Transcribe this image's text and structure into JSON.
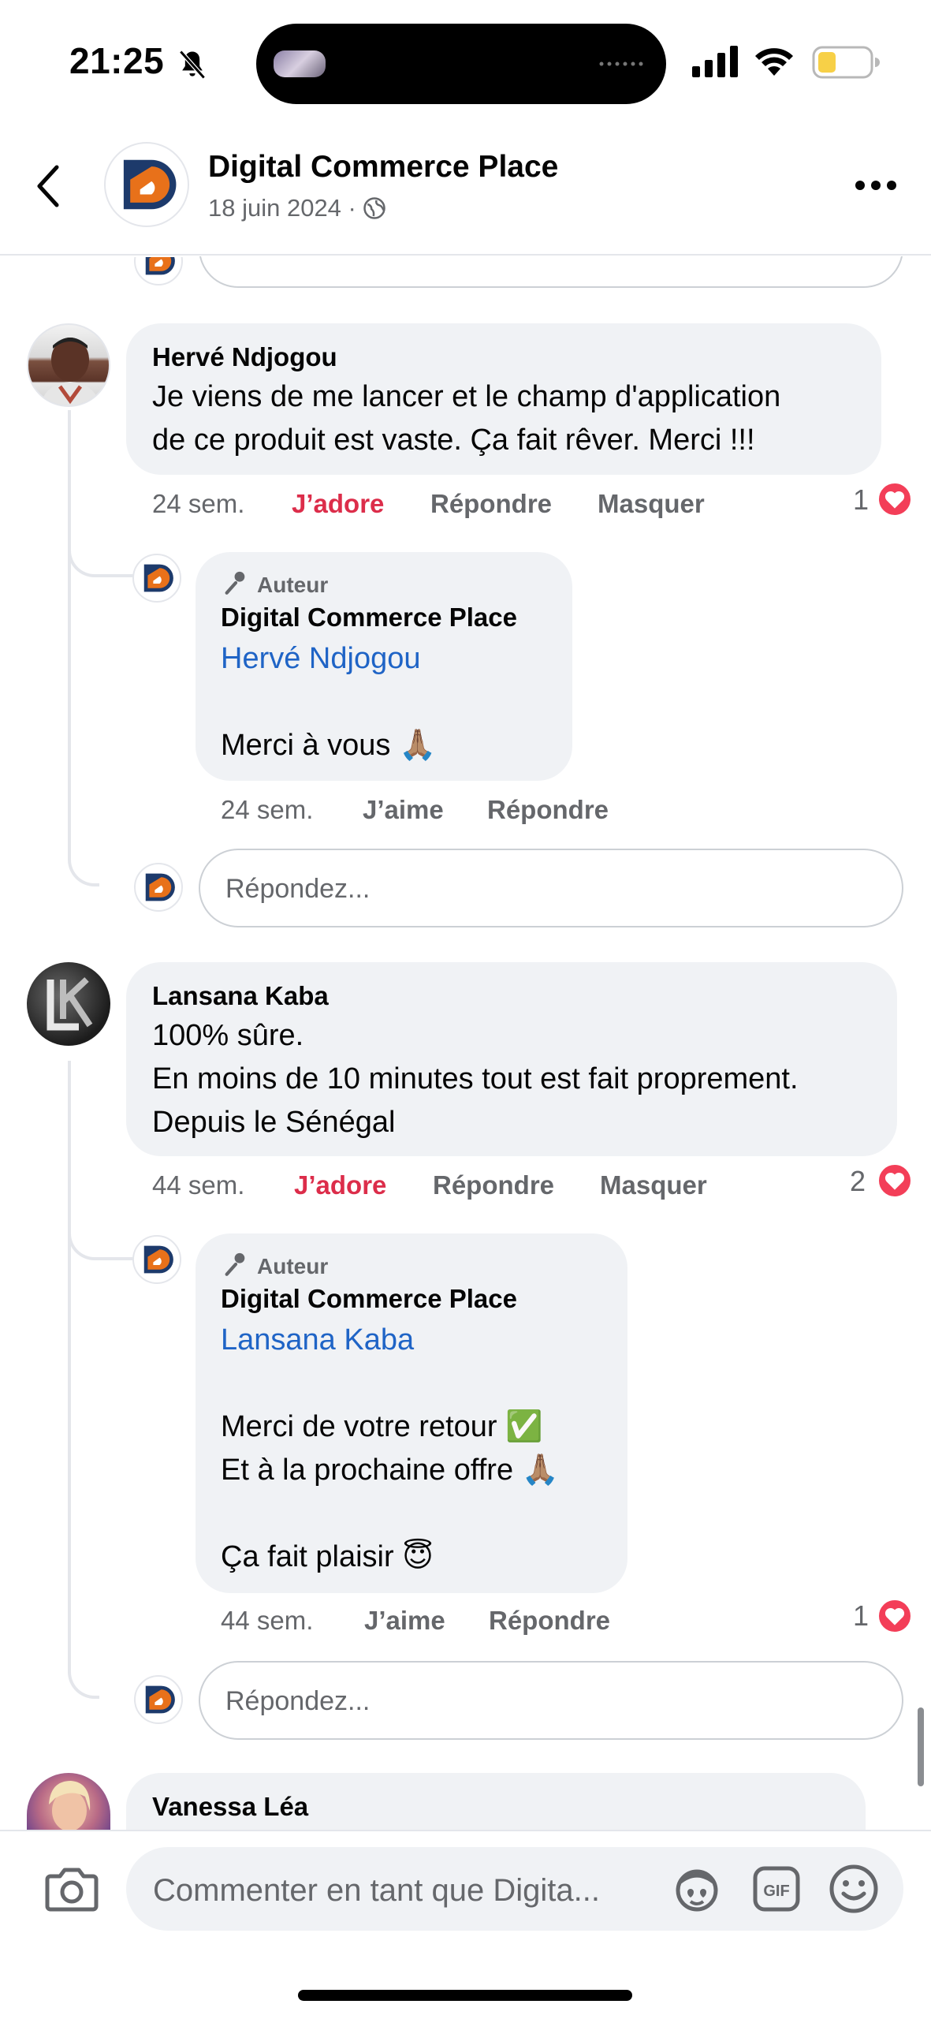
{
  "status_bar": {
    "time": "21:25",
    "battery_color": "#f7d047"
  },
  "header": {
    "title": "Digital Commerce Place",
    "date": "18 juin 2024 · "
  },
  "labels": {
    "author": "Auteur",
    "reply_placeholder": "Répondez..."
  },
  "comments": [
    {
      "name": "Hervé Ndjogou",
      "text": "Je viens de me lancer et le champ d'application\nde ce produit est vaste. Ça fait rêver. Merci !!!",
      "time": "24 sem.",
      "reaction": "J’adore",
      "reply": "Répondre",
      "hide": "Masquer",
      "count": "1",
      "author_reply": {
        "name": "Digital Commerce Place",
        "mention": "Hervé Ndjogou",
        "text": "Merci à vous 🙏🏽",
        "time": "24 sem.",
        "like": "J’aime",
        "reply": "Répondre"
      }
    },
    {
      "name": "Lansana Kaba",
      "text": "100% sûre.\nEn moins de 10 minutes tout est fait proprement.\nDepuis le Sénégal",
      "time": "44 sem.",
      "reaction": "J’adore",
      "reply": "Répondre",
      "hide": "Masquer",
      "count": "2",
      "author_reply": {
        "name": "Digital Commerce Place",
        "mention": "Lansana Kaba",
        "text": "Merci de votre retour ✅\nEt à la prochaine offre 🙏🏽\n\nÇa fait plaisir 😇",
        "time": "44 sem.",
        "like": "J’aime",
        "reply": "Répondre",
        "count": "1"
      }
    },
    {
      "name": "Vanessa Léa"
    }
  ],
  "composer": {
    "placeholder": "Commenter en tant que Digita..."
  },
  "colors": {
    "loved": "#dc2d4a",
    "mention": "#1f64c6",
    "heart": "#f33e58",
    "logo_orange": "#e8711a",
    "logo_navy": "#1d3a6b"
  }
}
